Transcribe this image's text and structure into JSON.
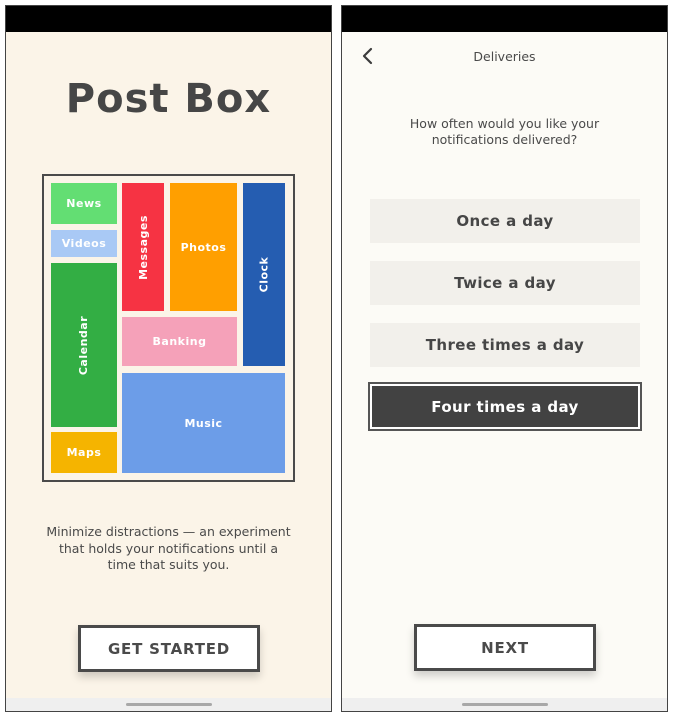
{
  "left_screen": {
    "app_title": "Post Box",
    "app_grid": {
      "tiles": [
        {
          "name": "News",
          "color": "#63de73",
          "orientation": "horizontal"
        },
        {
          "name": "Videos",
          "color": "#a9c9f5",
          "orientation": "horizontal"
        },
        {
          "name": "Calendar",
          "color": "#33ae44",
          "orientation": "vertical"
        },
        {
          "name": "Maps",
          "color": "#f5b400",
          "orientation": "horizontal"
        },
        {
          "name": "Messages",
          "color": "#f63343",
          "orientation": "vertical"
        },
        {
          "name": "Photos",
          "color": "#ff9f00",
          "orientation": "horizontal"
        },
        {
          "name": "Clock",
          "color": "#255db1",
          "orientation": "vertical"
        },
        {
          "name": "Banking",
          "color": "#f5a1b9",
          "orientation": "horizontal"
        },
        {
          "name": "Music",
          "color": "#6c9de8",
          "orientation": "horizontal"
        }
      ]
    },
    "tagline": "Minimize distractions — an experiment that holds your notifications until a time that suits you.",
    "cta_label": "GET STARTED"
  },
  "right_screen": {
    "back_icon": "chevron-left-icon",
    "title": "Deliveries",
    "question": "How often would you like your notifications delivered?",
    "options": [
      {
        "label": "Once a day",
        "selected": false
      },
      {
        "label": "Twice a day",
        "selected": false
      },
      {
        "label": "Three times a day",
        "selected": false
      },
      {
        "label": "Four times a day",
        "selected": true
      }
    ],
    "next_label": "NEXT"
  },
  "colors": {
    "left_background": "#fbf4e8",
    "right_background": "#fcfbf6",
    "text_dark": "#464646",
    "selected_option": "#424242",
    "option_background": "#f2f0eb"
  }
}
